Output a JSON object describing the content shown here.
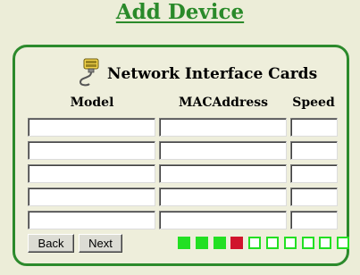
{
  "page": {
    "title": "Add Device"
  },
  "panel": {
    "heading": "Network Interface Cards",
    "icon": "serial-cable-icon"
  },
  "table": {
    "columns": [
      "Model",
      "MACAddress",
      "Speed"
    ],
    "rows": [
      {
        "model": "",
        "mac": "",
        "speed": ""
      },
      {
        "model": "",
        "mac": "",
        "speed": ""
      },
      {
        "model": "",
        "mac": "",
        "speed": ""
      },
      {
        "model": "",
        "mac": "",
        "speed": ""
      },
      {
        "model": "",
        "mac": "",
        "speed": ""
      }
    ]
  },
  "buttons": {
    "back_label": "Back",
    "next_label": "Next"
  },
  "progress": {
    "total_steps": 10,
    "completed_steps": 3,
    "current_step": 4,
    "colors": {
      "done": "#22e022",
      "current": "#d0142c",
      "todo": "#ffffff"
    }
  }
}
